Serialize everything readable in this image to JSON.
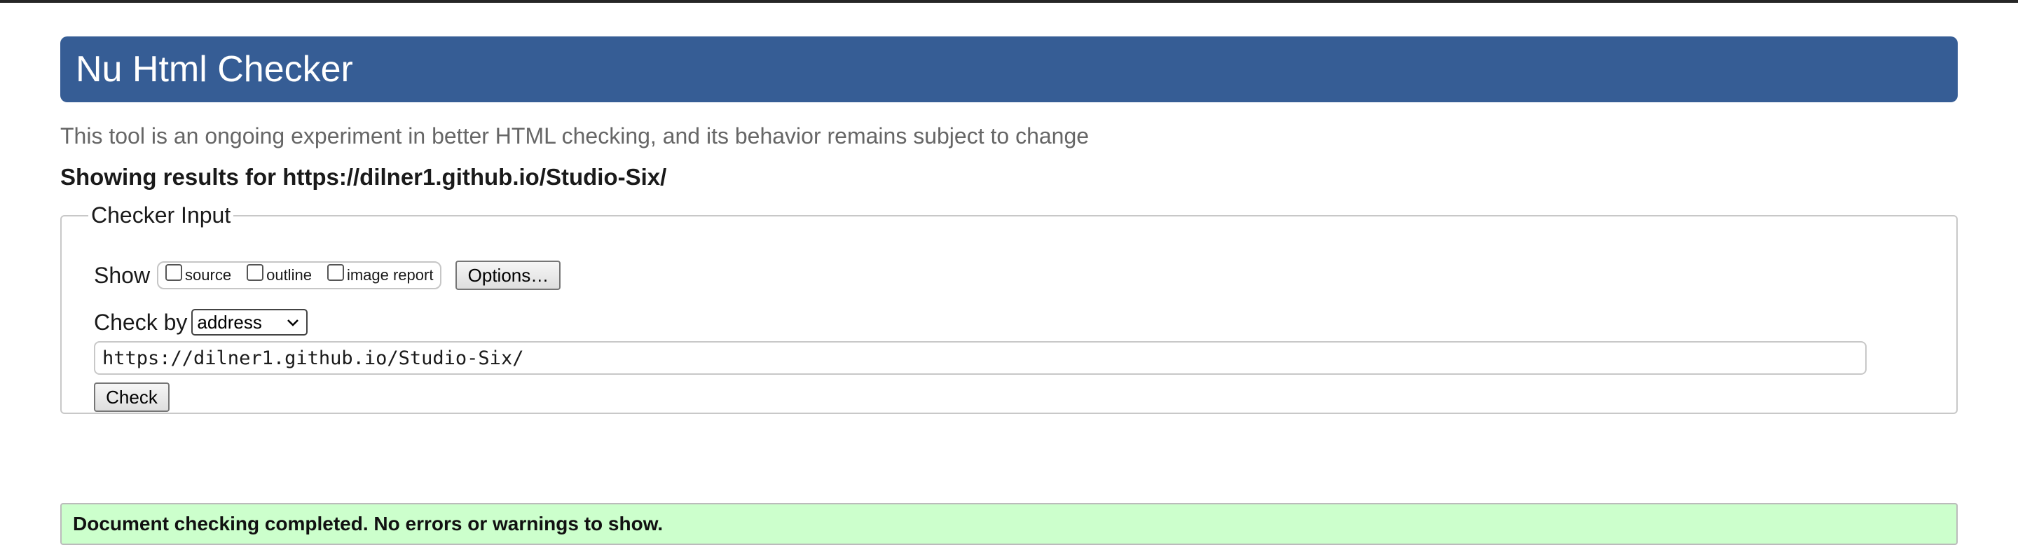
{
  "header": {
    "title": "Nu Html Checker",
    "accent_color": "#365d95"
  },
  "tagline": "This tool is an ongoing experiment in better HTML checking, and its behavior remains subject to change",
  "results_for": "Showing results for https://dilner1.github.io/Studio-Six/",
  "checker": {
    "legend": "Checker Input",
    "show_label": "Show",
    "show_options": [
      {
        "label": "source",
        "checked": false
      },
      {
        "label": "outline",
        "checked": false
      },
      {
        "label": "image report",
        "checked": false
      }
    ],
    "options_button": "Options…",
    "check_by_label": "Check by",
    "check_by_selected": "address",
    "url_value": "https://dilner1.github.io/Studio-Six/",
    "check_button": "Check"
  },
  "status": {
    "message": "Document checking completed. No errors or warnings to show.",
    "color": "#ccffcc"
  }
}
